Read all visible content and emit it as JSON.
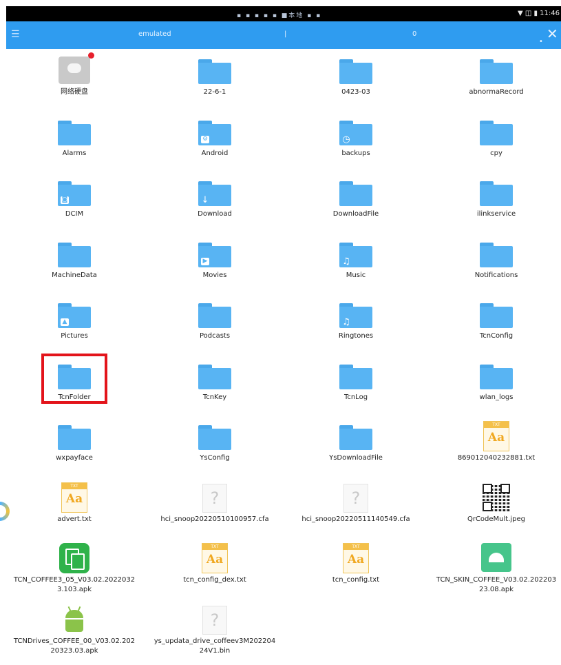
{
  "status_bar": {
    "center_text": "▪ ▪ ▪ ▪ ▪ ■本地 ▪ ▪",
    "right_icons": "▼ ◫ ▮",
    "time": "11:46"
  },
  "app_bar": {
    "path": "emulated",
    "separator": "|",
    "selected_count": "0",
    "close_symbol": "✕"
  },
  "files": [
    {
      "name": "网络硬盘",
      "kind": "cloud"
    },
    {
      "name": "22-6-1",
      "kind": "folder"
    },
    {
      "name": "0423-03",
      "kind": "folder"
    },
    {
      "name": "abnormaRecord",
      "kind": "folder"
    },
    {
      "name": "Alarms",
      "kind": "folder"
    },
    {
      "name": "Android",
      "kind": "folder",
      "badge": "gear-icon"
    },
    {
      "name": "backups",
      "kind": "folder",
      "badge": "history-icon"
    },
    {
      "name": "cpy",
      "kind": "folder"
    },
    {
      "name": "DCIM",
      "kind": "folder",
      "badge": "camera-icon"
    },
    {
      "name": "Download",
      "kind": "folder",
      "badge": "download-arrow-icon"
    },
    {
      "name": "DownloadFile",
      "kind": "folder"
    },
    {
      "name": "ilinkservice",
      "kind": "folder"
    },
    {
      "name": "MachineData",
      "kind": "folder"
    },
    {
      "name": "Movies",
      "kind": "folder",
      "badge": "play-icon"
    },
    {
      "name": "Music",
      "kind": "folder",
      "badge": "music-note-icon"
    },
    {
      "name": "Notifications",
      "kind": "folder"
    },
    {
      "name": "Pictures",
      "kind": "folder",
      "badge": "image-icon"
    },
    {
      "name": "Podcasts",
      "kind": "folder"
    },
    {
      "name": "Ringtones",
      "kind": "folder",
      "badge": "music-note-icon"
    },
    {
      "name": "TcnConfig",
      "kind": "folder"
    },
    {
      "name": "TcnFolder",
      "kind": "folder"
    },
    {
      "name": "TcnKey",
      "kind": "folder"
    },
    {
      "name": "TcnLog",
      "kind": "folder"
    },
    {
      "name": "wlan_logs",
      "kind": "folder"
    },
    {
      "name": "wxpayface",
      "kind": "folder"
    },
    {
      "name": "YsConfig",
      "kind": "folder"
    },
    {
      "name": "YsDownloadFile",
      "kind": "folder"
    },
    {
      "name": "869012040232881.txt",
      "kind": "txt"
    },
    {
      "name": "advert.txt",
      "kind": "txt"
    },
    {
      "name": "hci_snoop20220510100957.cfa",
      "kind": "unknown"
    },
    {
      "name": "hci_snoop20220511140549.cfa",
      "kind": "unknown"
    },
    {
      "name": "QrCodeMult.jpeg",
      "kind": "qr"
    },
    {
      "name": "TCN_COFFEE3_05_V03.02.2022032\n3.103.apk",
      "kind": "apk-green"
    },
    {
      "name": "tcn_config_dex.txt",
      "kind": "txt"
    },
    {
      "name": "tcn_config.txt",
      "kind": "txt"
    },
    {
      "name": "TCN_SKIN_COFFEE_V03.02.202203\n23.08.apk",
      "kind": "apk-box"
    },
    {
      "name": "TCNDrives_COFFEE_00_V03.02.202\n20323.03.apk",
      "kind": "apk-android"
    },
    {
      "name": "ys_updata_drive_coffeev3M202204\n24V1.bin",
      "kind": "unknown"
    }
  ],
  "txt_badge_text": "TXT",
  "txt_glyph_text": "Aa",
  "unknown_glyph_text": "?",
  "highlighted_item": "TcnFolder",
  "colors": {
    "app_bar": "#2f9cf0",
    "folder": "#58b4f3",
    "highlight": "#e3141b"
  }
}
